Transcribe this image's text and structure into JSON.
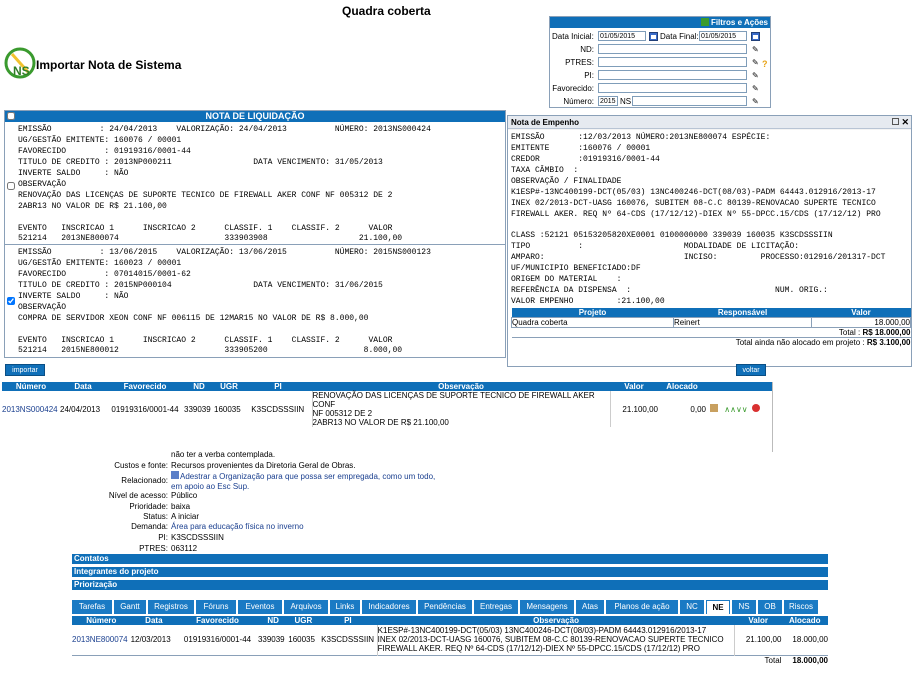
{
  "page": {
    "title": "Quadra coberta"
  },
  "import_header": {
    "label": "Importar Nota de Sistema"
  },
  "filters": {
    "title": "Filtros e Ações",
    "data_inicial_label": "Data Inicial:",
    "data_inicial": "01/05/2015",
    "data_final_label": "Data Final:",
    "data_final": "01/05/2015",
    "nd_label": "ND:",
    "ptres_label": "PTRES:",
    "pi_label": "PI:",
    "favorecido_label": "Favorecido:",
    "numero_label": "Número:",
    "numero_year": "2015",
    "numero_ns": "NS"
  },
  "liquidacao": {
    "title": "NOTA DE LIQUIDAÇÃO",
    "record1": {
      "l1": "EMISSÃO          : 24/04/2013    VALORIZAÇÃO: 24/04/2013          NÚMERO: 2013NS000424",
      "l2": "UG/GESTÃO EMITENTE: 160076 / 00001",
      "l3": "FAVORECIDO        : 01919316/0001-44",
      "l4": "TITULO DE CREDITO : 2013NP000211                 DATA VENCIMENTO: 31/05/2013",
      "l5": "INVERTE SALDO     : NÃO",
      "l6": "OBSERVAÇÃO",
      "l7": "RENOVAÇÃO DAS LICENÇAS DE SUPORTE TECNICO DE FIREWALL AKER CONF NF 005312 DE 2",
      "l8": "2ABR13 NO VALOR DE R$ 21.100,00",
      "l9": "EVENTO   INSCRICAO 1      INSCRICAO 2      CLASSIF. 1    CLASSIF. 2      VALOR",
      "l10": "521214   2013NE800074                      333903908                   21.100,00"
    },
    "record2": {
      "l1": "EMISSÃO          : 13/06/2015    VALORIZAÇÃO: 13/06/2015          NÚMERO: 2015NS000123",
      "l2": "UG/GESTÃO EMITENTE: 160023 / 00001",
      "l3": "FAVORECIDO        : 07014015/0001-62",
      "l4": "TITULO DE CREDITO : 2015NP000104                 DATA VENCIMENTO: 31/06/2015",
      "l5": "INVERTE SALDO     : NÃO",
      "l6": "OBSERVAÇÃO",
      "l7": "COMPRA DE SERVIDOR XEON CONF NF 006115 DE 12MAR15 NO VALOR DE R$ 8.000,00",
      "l9": "EVENTO   INSCRICAO 1      INSCRICAO 2      CLASSIF. 1    CLASSIF. 2      VALOR",
      "l10": "521214   2015NE800012                      333905200                    8.000,00"
    }
  },
  "empenho": {
    "title": "Nota de Empenho",
    "l1": "EMISSÃO       :12/03/2013 NÚMERO:2013NE800074 ESPÉCIE:",
    "l2": "EMITENTE      :160076 / 00001",
    "l3": "CREDOR        :01919316/0001-44",
    "l4": "TAXA CÂMBIO  :",
    "l5": "OBSERVAÇÃO / FINALIDADE",
    "l6": "K1ESP#-13NC400199-DCT(05/03) 13NC400246-DCT(08/03)-PADM 64443.012916/2013-17",
    "l7": "INEX 02/2013-DCT-UASG 160076, SUBITEM 08-C.C 80139-RENOVACAO SUPERTE TECNICO",
    "l8": "FIREWALL AKER. REQ Nº 64-CDS (17/12/12)-DIEX Nº 55-DPCC.15/CDS (17/12/12) PRO",
    "l9": "CLASS :52121 05153205820XE0001 0100000000 339039 160035 K3SCDSSSIIN",
    "l10": "TIPO          :                     MODALIDADE DE LICITAÇÃO:",
    "l11": "AMPARO:                             INCISO:         PROCESSO:012916/201317-DCT",
    "l12": "UF/MUNICIPIO BENEFICIADO:DF",
    "l13": "ORIGEM DO MATERIAL    :",
    "l14": "REFERÊNCIA DA DISPENSA  :                              NUM. ORIG.:",
    "l15": "VALOR EMPENHO         :21.100,00",
    "table": {
      "headers": [
        "Projeto",
        "Responsável",
        "Valor"
      ],
      "row": [
        "Quadra coberta",
        "Reinert",
        "18.000,00"
      ],
      "total_label": "Total :",
      "total_value": "R$ 18.000,00",
      "nao_alocado_label": "Total ainda não alocado em projeto :",
      "nao_alocado_value": "R$ 3.100,00"
    }
  },
  "buttons": {
    "importar": "importar",
    "voltar": "voltar"
  },
  "ns_table": {
    "headers": [
      "Número",
      "Data",
      "Favorecido",
      "ND",
      "UGR",
      "PI",
      "Observação",
      "Valor",
      "Alocado"
    ],
    "row": {
      "numero": "2013NS000424",
      "data": "24/04/2013",
      "favorecido": "01919316/0001-44",
      "nd": "339039",
      "ugr": "160035",
      "pi": "K3SCDSSSIIN",
      "obs1": "RENOVAÇÃO DAS LICENÇAS DE SUPORTE TECNICO DE FIREWALL AKER CONF",
      "obs2": "NF 005312 DE 2",
      "obs3": "2ABR13 NO VALOR DE R$ 21.100,00",
      "valor": "21.100,00",
      "alocado": "0,00"
    }
  },
  "details": {
    "top_text": "não ter a verba contemplada.",
    "custos_label": "Custos e fonte:",
    "custos_value": "Recursos provenientes da Diretoria Geral de Obras.",
    "relacionado_label": "Relacionado:",
    "relacionado_value1": "Adestrar a Organização para que possa ser empregada, como um todo,",
    "relacionado_value2": "em apoio ao Esc Sup.",
    "nivel_label": "Nível de acesso:",
    "nivel_value": "Público",
    "prioridade_label": "Prioridade:",
    "prioridade_value": "baixa",
    "status_label": "Status:",
    "status_value": "A iniciar",
    "demanda_label": "Demanda:",
    "demanda_value": "Área para educação física no inverno",
    "pi_label": "PI:",
    "pi_value": "K3SCDSSSIIN",
    "ptres_label": "PTRES:",
    "ptres_value": "063112"
  },
  "sections": [
    "Contatos",
    "Integrantes do projeto",
    "Priorização"
  ],
  "tabs": [
    "Tarefas",
    "Gantt",
    "Registros",
    "Fóruns",
    "Eventos",
    "Arquivos",
    "Links",
    "Indicadores",
    "Pendências",
    "Entregas",
    "Mensagens",
    "Atas",
    "Planos de ação",
    "NC",
    "NE",
    "NS",
    "OB",
    "Riscos"
  ],
  "ne_table": {
    "headers": [
      "Número",
      "Data",
      "Favorecido",
      "ND",
      "UGR",
      "PI",
      "Observação",
      "Valor",
      "Alocado"
    ],
    "row": {
      "numero": "2013NE800074",
      "data": "12/03/2013",
      "favorecido": "01919316/0001-44",
      "nd": "339039",
      "ugr": "160035",
      "pi": "K3SCDSSSIIN",
      "obs1": "K1ESP#-13NC400199-DCT(05/03) 13NC400246-DCT(08/03)-PADM 64443.012916/2013-17",
      "obs2": "INEX 02/2013-DCT-UASG 160076, SUBITEM 08-C.C 80139-RENOVACAO SUPERTE TECNICO",
      "obs3": "FIREWALL AKER. REQ Nº 64-CDS (17/12/12)-DIEX Nº 55-DPCC.15/CDS (17/12/12) PRO",
      "valor": "21.100,00",
      "alocado": "18.000,00"
    },
    "total_label": "Total",
    "total_value": "18.000,00"
  }
}
